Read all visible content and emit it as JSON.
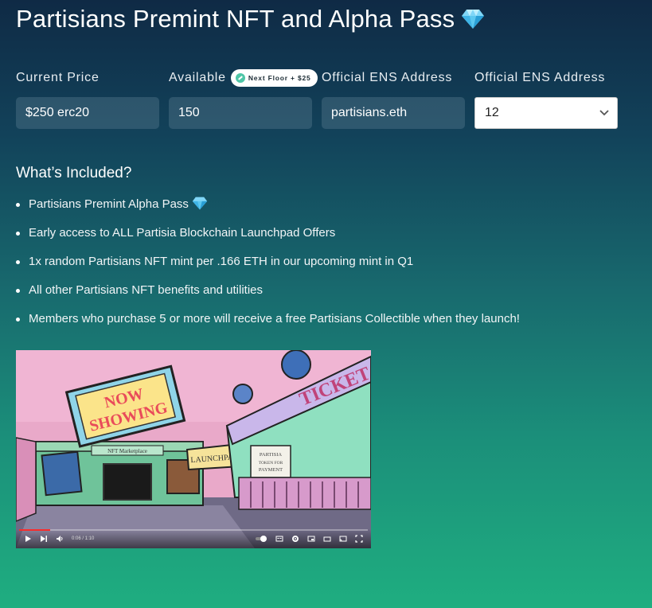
{
  "page": {
    "title": "Partisians Premint NFT and Alpha Pass",
    "title_icon": "gem-icon"
  },
  "fields": [
    {
      "label": "Current Price",
      "value": "$250 erc20",
      "type": "text"
    },
    {
      "label": "Available",
      "value": "150",
      "type": "text",
      "badge": "Next Floor + $25"
    },
    {
      "label": "Official ENS Address",
      "value": "partisians.eth",
      "type": "text"
    },
    {
      "label": "Official ENS Address",
      "value": "12",
      "type": "select"
    }
  ],
  "included": {
    "title": "What’s Included?",
    "items": [
      "Partisians Premint Alpha Pass",
      "Early access to ALL Partisia Blockchain Launchpad Offers",
      "1x random Partisians NFT mint per .166 ETH in our upcoming mint in Q1",
      "All other Partisians NFT benefits and utilities",
      "Members who purchase 5 or more will receive a free Partisians Collectible when they launch!"
    ]
  },
  "video": {
    "scene_text": {
      "sign_line1": "NOW",
      "sign_line2": "SHOWING",
      "ticket": "TICKET",
      "marketplace": "NFT Marketplace",
      "launchpad": "LAUNCHPAD",
      "partisia_sign": [
        "PARTISIA",
        "TOKEN FOR",
        "PAYMENT"
      ]
    },
    "time": "0:06 / 1:10",
    "progress": 0.09
  },
  "colors": {
    "accent_green": "#1fae80",
    "badge_dot": "#4fc6a7",
    "progress_red": "#ff2d2d"
  }
}
